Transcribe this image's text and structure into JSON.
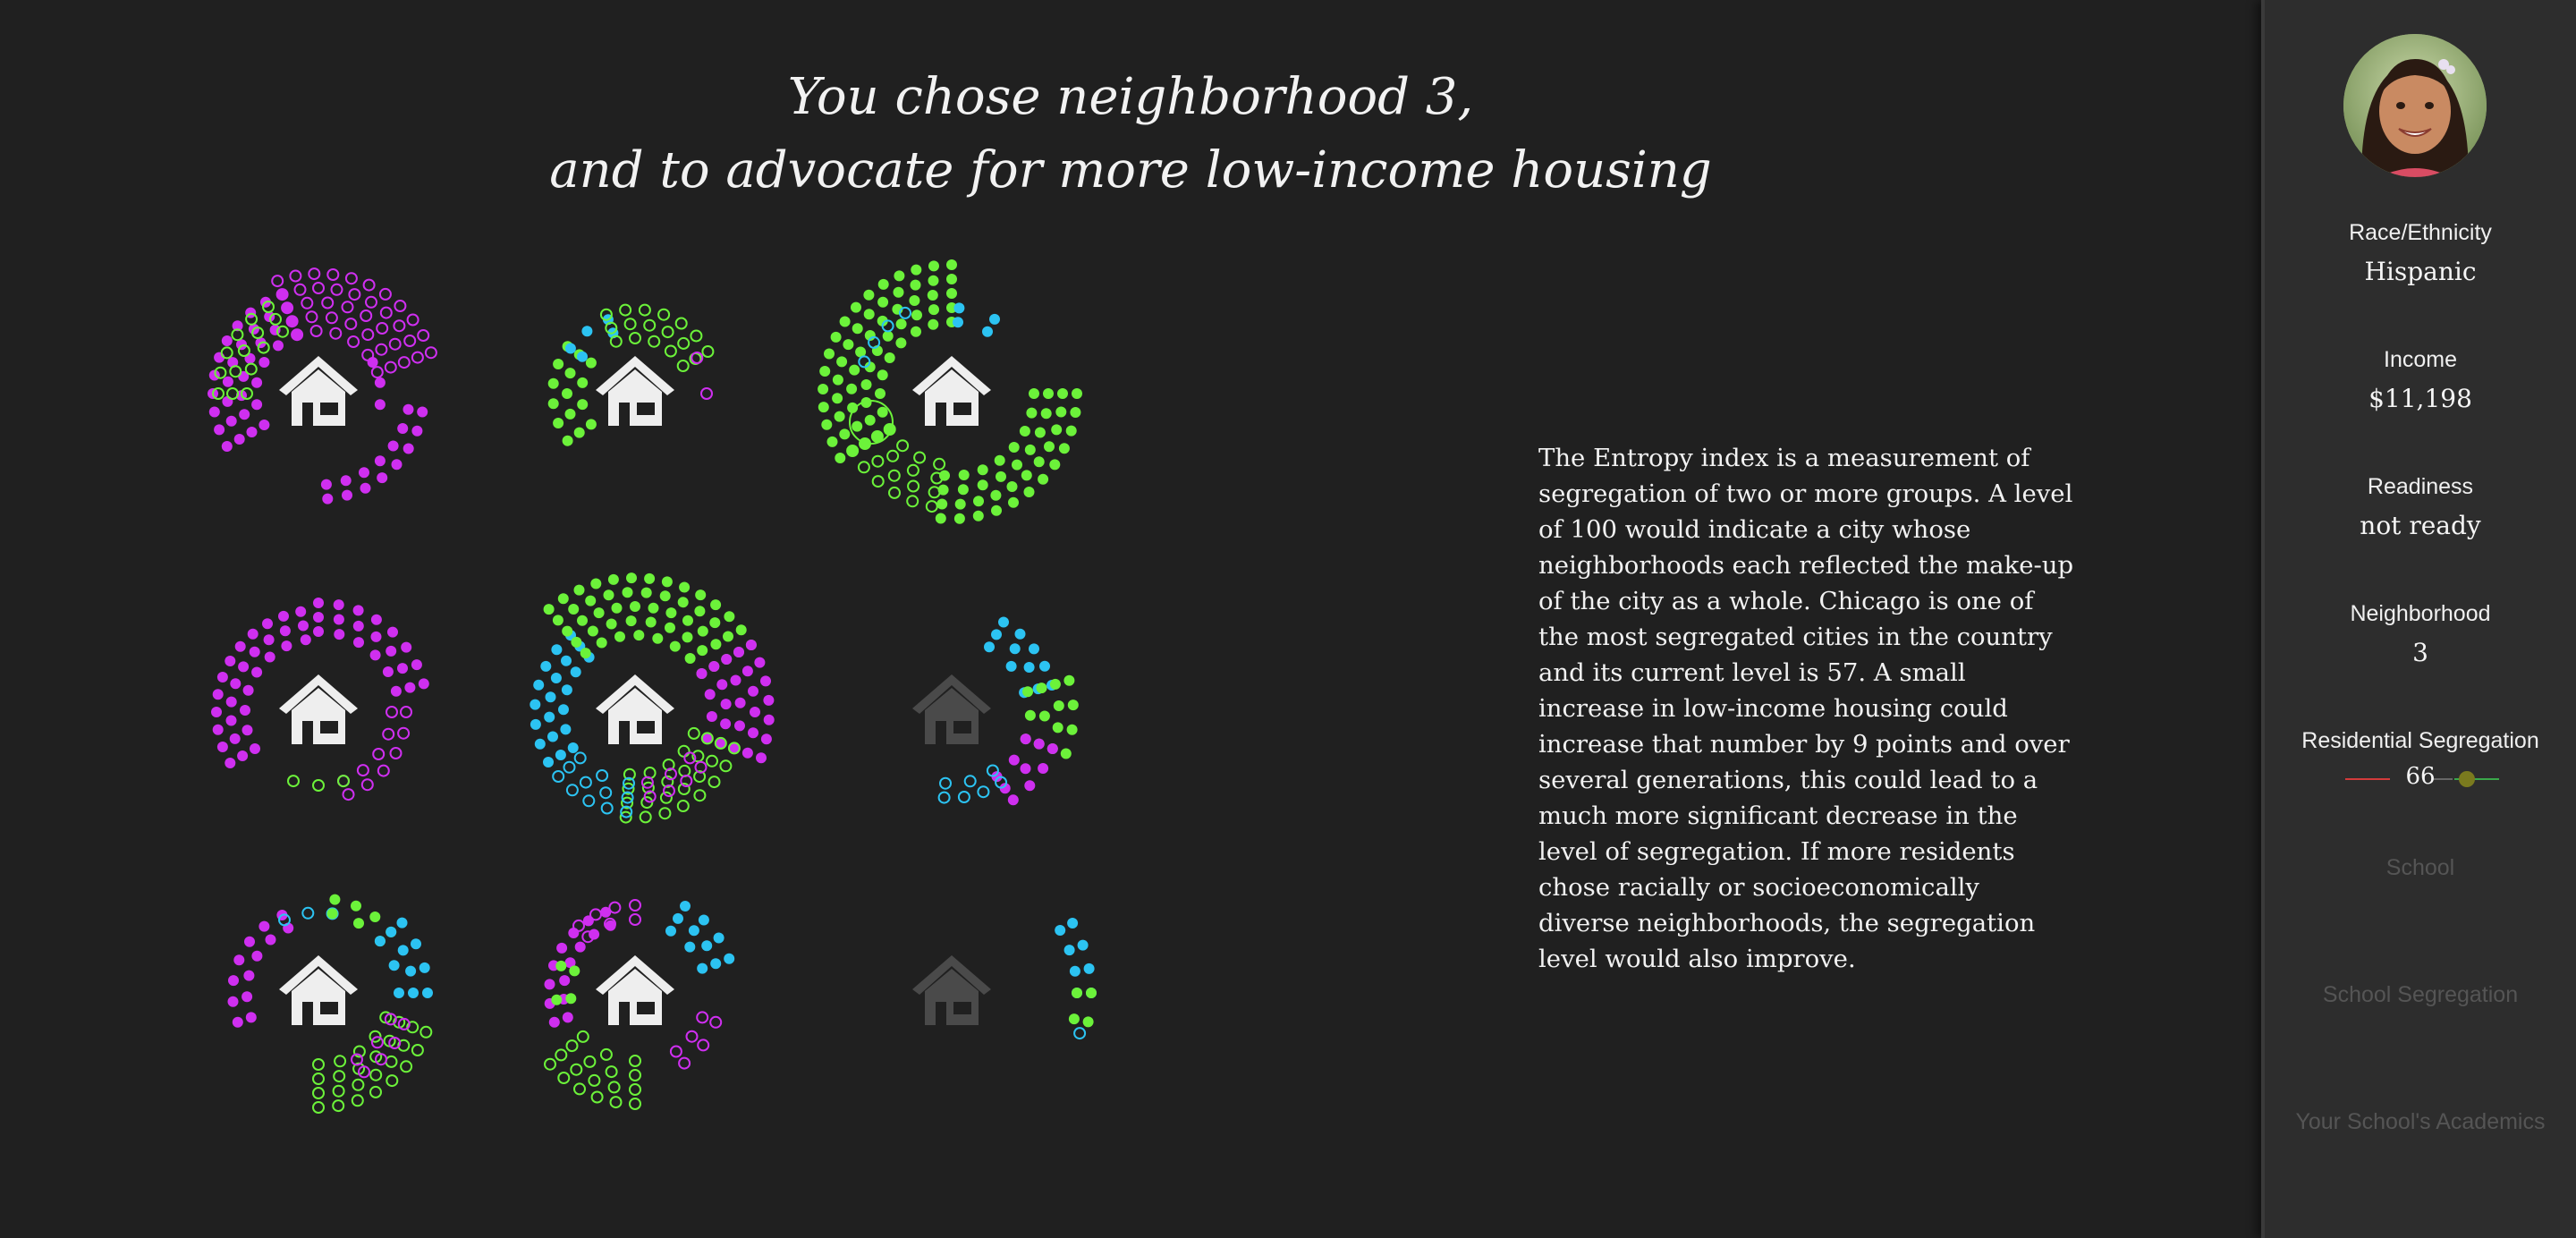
{
  "headline": {
    "line1": "You chose neighborhood 3,",
    "line2": "and to advocate for more low-income housing"
  },
  "description": "The Entropy index is a measurement of segregation of two or more groups. A level of 100 would indicate a city whose neighborhoods each reflected the make-up of the city as a whole. Chicago is one of the most segregated cities in the country and its current level is 57. A small increase in low-income housing could increase that number by 9 points and over several generations, this could lead to a much more significant decrease in the level of segregation. If more residents chose racially or socioeconomically diverse neighborhoods, the segregation level would also improve.",
  "colors": {
    "background": "#202020",
    "sidebar": "#2d2d2d",
    "magenta": "#cf2ff0",
    "green": "#6cf23a",
    "cyan": "#2cc3f2",
    "house": "#eeeeee",
    "house_dim": "#4a4a4a",
    "scale_red": "#d23b3b",
    "scale_green": "#3aa84a",
    "marker": "#7a7a1e"
  },
  "neighborhoods": [
    {
      "id": 1,
      "house_icon": "house-icon",
      "active": true
    },
    {
      "id": 2,
      "house_icon": "house-icon",
      "active": true
    },
    {
      "id": 3,
      "house_icon": "house-icon",
      "active": true,
      "chosen": true
    },
    {
      "id": 4,
      "house_icon": "house-icon",
      "active": true
    },
    {
      "id": 5,
      "house_icon": "house-icon",
      "active": true
    },
    {
      "id": 6,
      "house_icon": "house-icon",
      "active": false
    },
    {
      "id": 7,
      "house_icon": "house-icon",
      "active": true
    },
    {
      "id": 8,
      "house_icon": "house-icon",
      "active": true
    },
    {
      "id": 9,
      "house_icon": "house-icon",
      "active": false
    }
  ],
  "sidebar": {
    "avatar_icon": "avatar-photo",
    "race_label": "Race/Ethnicity",
    "race_value": "Hispanic",
    "income_label": "Income",
    "income_value": "$11,198",
    "readiness_label": "Readiness",
    "readiness_value": "not ready",
    "neighborhood_label": "Neighborhood",
    "neighborhood_value": "3",
    "segregation_label": "Residential Segregation",
    "segregation_value": "66",
    "school_label": "School",
    "school_seg_label": "School Segregation",
    "academics_label": "Your School's Academics"
  }
}
